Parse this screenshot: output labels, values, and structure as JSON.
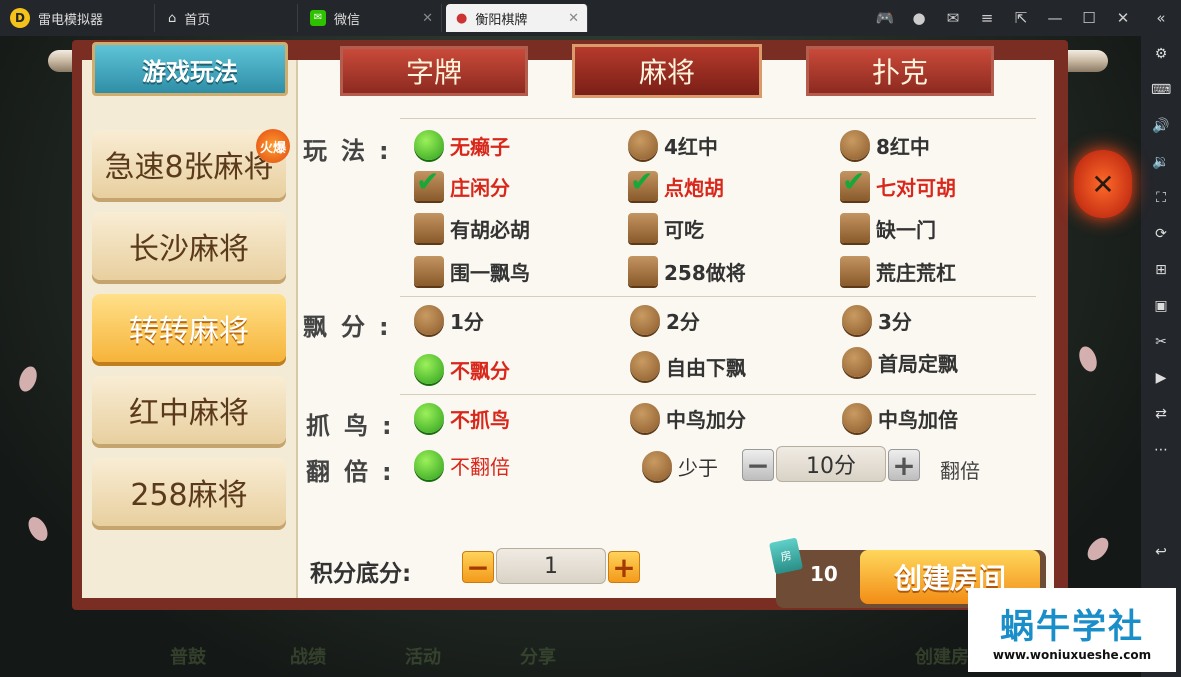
{
  "titlebar": {
    "app_name": "雷电模拟器",
    "tabs": [
      {
        "label": "首页"
      },
      {
        "label": "微信"
      },
      {
        "label": "衡阳棋牌"
      }
    ]
  },
  "game": {
    "rules_tab": "游戏玩法",
    "categories": [
      "字牌",
      "麻将",
      "扑克"
    ],
    "active_category": "麻将",
    "modes": [
      "急速8张麻将",
      "长沙麻将",
      "转转麻将",
      "红中麻将",
      "258麻将"
    ],
    "selected_mode": "转转麻将",
    "hot_badge": "火爆",
    "play": {
      "label": "玩法:",
      "options": [
        {
          "text": "无癞子",
          "type": "radio",
          "selected": true
        },
        {
          "text": "4红中",
          "type": "radio",
          "selected": false
        },
        {
          "text": "8红中",
          "type": "radio",
          "selected": false
        },
        {
          "text": "庄闲分",
          "type": "check",
          "selected": true
        },
        {
          "text": "点炮胡",
          "type": "check",
          "selected": true
        },
        {
          "text": "七对可胡",
          "type": "check",
          "selected": true
        },
        {
          "text": "有胡必胡",
          "type": "check",
          "selected": false
        },
        {
          "text": "可吃",
          "type": "check",
          "selected": false
        },
        {
          "text": "缺一门",
          "type": "check",
          "selected": false
        },
        {
          "text": "围一飘鸟",
          "type": "check",
          "selected": false
        },
        {
          "text": "258做将",
          "type": "check",
          "selected": false
        },
        {
          "text": "荒庄荒杠",
          "type": "check",
          "selected": false
        }
      ]
    },
    "piao": {
      "label": "飘分:",
      "options": [
        {
          "text": "1分",
          "selected": false
        },
        {
          "text": "2分",
          "selected": false
        },
        {
          "text": "3分",
          "selected": false
        },
        {
          "text": "不飘分",
          "selected": true
        },
        {
          "text": "自由下飘",
          "selected": false
        },
        {
          "text": "首局定飘",
          "selected": false
        }
      ]
    },
    "bird": {
      "label": "抓鸟:",
      "options": [
        {
          "text": "不抓鸟",
          "selected": true
        },
        {
          "text": "中鸟加分",
          "selected": false
        },
        {
          "text": "中鸟加倍",
          "selected": false
        }
      ]
    },
    "double": {
      "label": "翻倍:",
      "options": [
        {
          "text": "不翻倍",
          "selected": true
        },
        {
          "text": "少于",
          "selected": false
        }
      ],
      "stepper_value": "10分",
      "suffix": "翻倍"
    },
    "base_score": {
      "label": "积分底分:",
      "value": "1"
    },
    "room_cost": "10",
    "create_room": "创建房间",
    "bottom_nav": [
      "普鼓",
      "战绩",
      "活动",
      "分享",
      "创建房"
    ]
  },
  "watermark": {
    "title": "蜗牛学社",
    "url": "www.woniuxueshe.com"
  },
  "colors": {
    "selected_text": "#d8281c",
    "panel_frame": "#7a2d22",
    "accent_orange": "#f39a1a",
    "tab_teal": "#2f8ea7"
  }
}
